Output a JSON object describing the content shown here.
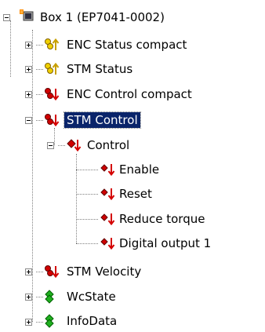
{
  "tree": {
    "root": {
      "label": "Box 1 (EP7041-0002)",
      "icon": "box-device-icon"
    },
    "items": [
      {
        "label": "ENC Status compact",
        "icon": "input-variable-icon"
      },
      {
        "label": "STM Status",
        "icon": "input-variable-icon"
      },
      {
        "label": "ENC Control compact",
        "icon": "output-variable-icon"
      },
      {
        "label": "STM Control",
        "icon": "output-variable-icon",
        "selected": true,
        "children": [
          {
            "label": "Control",
            "icon": "output-variable-icon",
            "children": [
              {
                "label": "Enable",
                "icon": "output-bit-icon"
              },
              {
                "label": "Reset",
                "icon": "output-bit-icon"
              },
              {
                "label": "Reduce torque",
                "icon": "output-bit-icon"
              },
              {
                "label": "Digital output 1",
                "icon": "output-bit-icon"
              }
            ]
          }
        ]
      },
      {
        "label": "STM Velocity",
        "icon": "output-variable-icon"
      },
      {
        "label": "WcState",
        "icon": "status-variable-icon"
      },
      {
        "label": "InfoData",
        "icon": "status-variable-icon"
      }
    ]
  },
  "colors": {
    "selection": "#0a246a",
    "input_arrow": "#c8a000",
    "output_arrow": "#d40000",
    "green": "#00a000"
  }
}
